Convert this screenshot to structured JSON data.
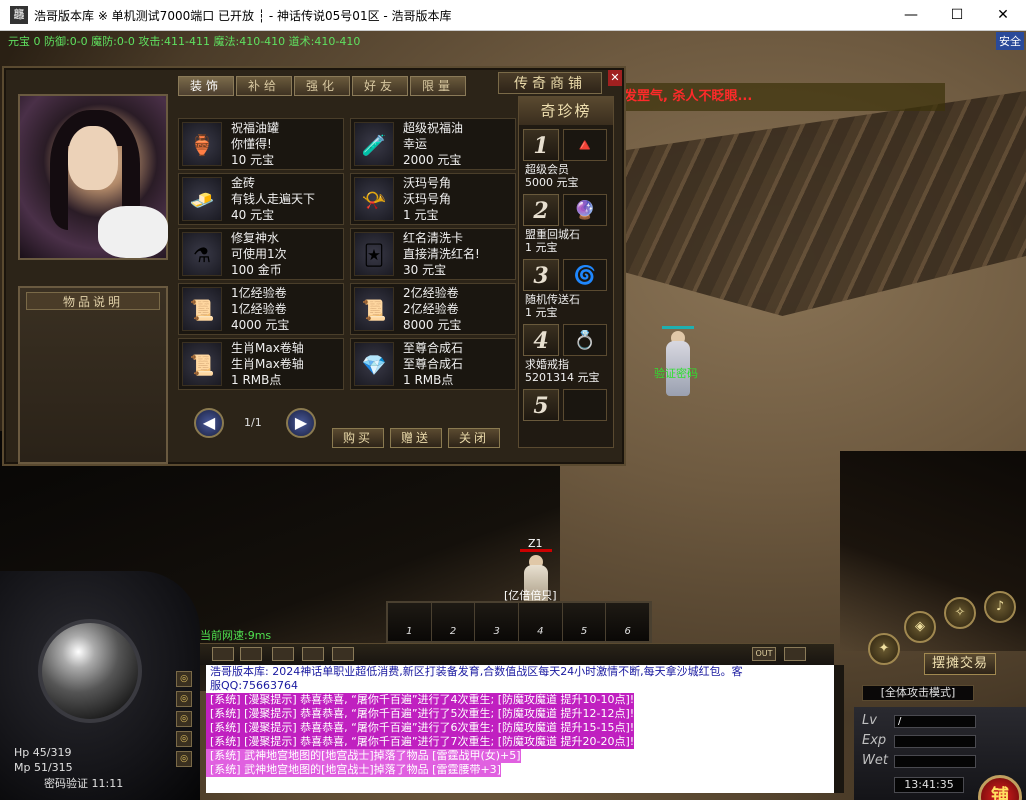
{
  "window": {
    "title": "浩哥版本库 ※ 单机测试7000端口 已开放 ┆ - 神话传说05号01区 - 浩哥版本库",
    "min": "—",
    "max": "☐",
    "close": "✕"
  },
  "hud_top": {
    "stats": "元宝 0 防御:0-0 魔防:0-0 攻击:411-411 魔法:410-410 道术:410-410",
    "safe": "安全"
  },
  "scroll_message": "发罡气, 杀人不眨眼...",
  "npcs": {
    "verify": "验证密码",
    "player_level": "Z1",
    "player_name": "[亿倍倍只]"
  },
  "shop": {
    "title": "传奇商铺",
    "tabs": [
      "装饰",
      "补给",
      "强化",
      "好友",
      "限量"
    ],
    "desc_title": "物品说明",
    "items": [
      {
        "name": "祝福油罐",
        "line2": "你懂得!",
        "price": "10 元宝",
        "icon": "🏺"
      },
      {
        "name": "超级祝福油",
        "line2": "幸运",
        "price": "2000 元宝",
        "icon": "🧪"
      },
      {
        "name": "金砖",
        "line2": "有钱人走遍天下",
        "price": "40 元宝",
        "icon": "🧈"
      },
      {
        "name": "沃玛号角",
        "line2": "沃玛号角",
        "price": "1 元宝",
        "icon": "📯"
      },
      {
        "name": "修复神水",
        "line2": "可使用1次",
        "price": "100 金币",
        "icon": "⚗"
      },
      {
        "name": "红名清洗卡",
        "line2": "直接清洗红名!",
        "price": "30 元宝",
        "icon": "🃏"
      },
      {
        "name": "1亿经验卷",
        "line2": "1亿经验卷",
        "price": "4000 元宝",
        "icon": "📜"
      },
      {
        "name": "2亿经验卷",
        "line2": "2亿经验卷",
        "price": "8000 元宝",
        "icon": "📜"
      },
      {
        "name": "生肖Max卷轴",
        "line2": "生肖Max卷轴",
        "price": "1 RMB点",
        "icon": "📜"
      },
      {
        "name": "至尊合成石",
        "line2": "至尊合成石",
        "price": "1 RMB点",
        "icon": "💎"
      }
    ],
    "page": "1/1",
    "buttons": {
      "buy": "购买",
      "gift": "赠送",
      "close": "关闭"
    },
    "rank_title": "奇珍榜",
    "rank": [
      {
        "num": "1",
        "name": "超级会员",
        "price": "5000 元宝",
        "icon": "🔺"
      },
      {
        "num": "2",
        "name": "盟重回城石",
        "price": "1 元宝",
        "icon": "🔮"
      },
      {
        "num": "3",
        "name": "随机传送石",
        "price": "1 元宝",
        "icon": "🌀"
      },
      {
        "num": "4",
        "name": "求婚戒指",
        "price": "5201314 元宝",
        "icon": "💍"
      },
      {
        "num": "5",
        "name": "",
        "price": "",
        "icon": ""
      }
    ]
  },
  "hud": {
    "net_speed": "当前网速:9ms",
    "hp": "Hp  45/319",
    "mp": "Mp  51/315",
    "verify": "密码验证 11:11",
    "hotbar": [
      "1",
      "2",
      "3",
      "4",
      "5",
      "6"
    ],
    "chat_btn_out": "OUT",
    "stall": "摆摊交易",
    "attack_mode": "[全体攻击模式]",
    "lv_label": "Lv",
    "lv_value": "/",
    "exp_label": "Exp",
    "wet_label": "Wet",
    "clock": "13:41:35",
    "shop_btn": "铺"
  },
  "chat": [
    {
      "type": "sys",
      "text": "浩哥版本库: 2024神话单职业超低消费,新区打装备发育,合数值战区每天24小时激情不断,每天拿沙城红包。客"
    },
    {
      "type": "sys",
      "text": "服QQ:75663764"
    },
    {
      "type": "p",
      "text": "[系统] [漫聚提示] 恭喜恭喜, “屠你千百遍”进行了4次重生; [防魔攻魔道 提升10-10点]!"
    },
    {
      "type": "p",
      "text": "[系统] [漫聚提示] 恭喜恭喜, “屠你千百遍”进行了5次重生; [防魔攻魔道 提升12-12点]!"
    },
    {
      "type": "p",
      "text": "[系统] [漫聚提示] 恭喜恭喜, “屠你千百遍”进行了6次重生; [防魔攻魔道 提升15-15点]!"
    },
    {
      "type": "p",
      "text": "[系统] [漫聚提示] 恭喜恭喜, “屠你千百遍”进行了7次重生; [防魔攻魔道 提升20-20点]!"
    },
    {
      "type": "pb",
      "text": "[系统] 武神地宫地图的[地宫战士]掉落了物品 [雷霆战甲(女)+5]"
    },
    {
      "type": "pb",
      "text": "[系统] 武神地宫地图的[地宫战士]掉落了物品 [雷霆腰带+3]"
    }
  ]
}
